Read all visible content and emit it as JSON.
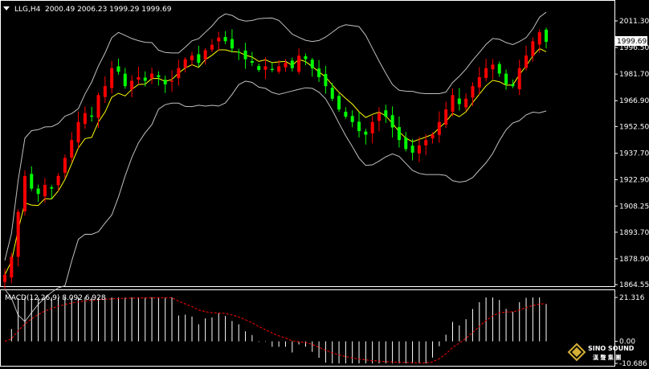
{
  "header": {
    "symbol": "LLG,H4",
    "ohlc": "2000.49 2006.23 1999.29 1999.69"
  },
  "price_panel": {
    "current_price_label": "1999.69",
    "y_ticks": [
      "2011.30",
      "1996.50",
      "1981.70",
      "1966.90",
      "1952.50",
      "1937.70",
      "1922.90",
      "1908.25",
      "1893.70",
      "1878.90",
      "1864.55"
    ]
  },
  "macd_panel": {
    "label": "MACD(12,26,9) 8.092 6.928",
    "y_ticks": [
      "21.316",
      "0.00",
      "-10.686"
    ]
  },
  "colors": {
    "bull": "#ff0000",
    "bear": "#00ff00",
    "bands": "#c0c0c0",
    "ma": "#ffff00",
    "macd_hist": "#ffffff",
    "signal": "#ff0000",
    "axis": "#ffffff"
  },
  "logo": {
    "name": "SINO SOUND",
    "sub": "漢 聲 集 團"
  },
  "chart_data": {
    "type": "candlestick",
    "price_range": [
      1864.55,
      2011.3
    ],
    "indicators": [
      "Bollinger Bands",
      "Moving Average",
      "MACD(12,26,9)"
    ],
    "close_series": [
      1870,
      1880,
      1905,
      1925,
      1918,
      1915,
      1920,
      1918,
      1925,
      1935,
      1945,
      1955,
      1960,
      1958,
      1970,
      1975,
      1985,
      1983,
      1975,
      1978,
      1980,
      1978,
      1982,
      1980,
      1976,
      1978,
      1985,
      1990,
      1992,
      1988,
      1995,
      1998,
      2002,
      2000,
      1996,
      1994,
      1990,
      1988,
      1984,
      1986,
      1984,
      1986,
      1988,
      1985,
      1992,
      1990,
      1985,
      1980,
      1975,
      1968,
      1962,
      1958,
      1955,
      1950,
      1948,
      1955,
      1960,
      1958,
      1952,
      1945,
      1940,
      1938,
      1942,
      1945,
      1948,
      1955,
      1962,
      1970,
      1965,
      1968,
      1975,
      1980,
      1985,
      1987,
      1982,
      1976,
      1975,
      1985,
      1992,
      2000,
      2005,
      1999.69
    ],
    "macd": {
      "value": 8.092,
      "signal": 6.928,
      "range": [
        -10.686,
        21.316
      ]
    }
  }
}
